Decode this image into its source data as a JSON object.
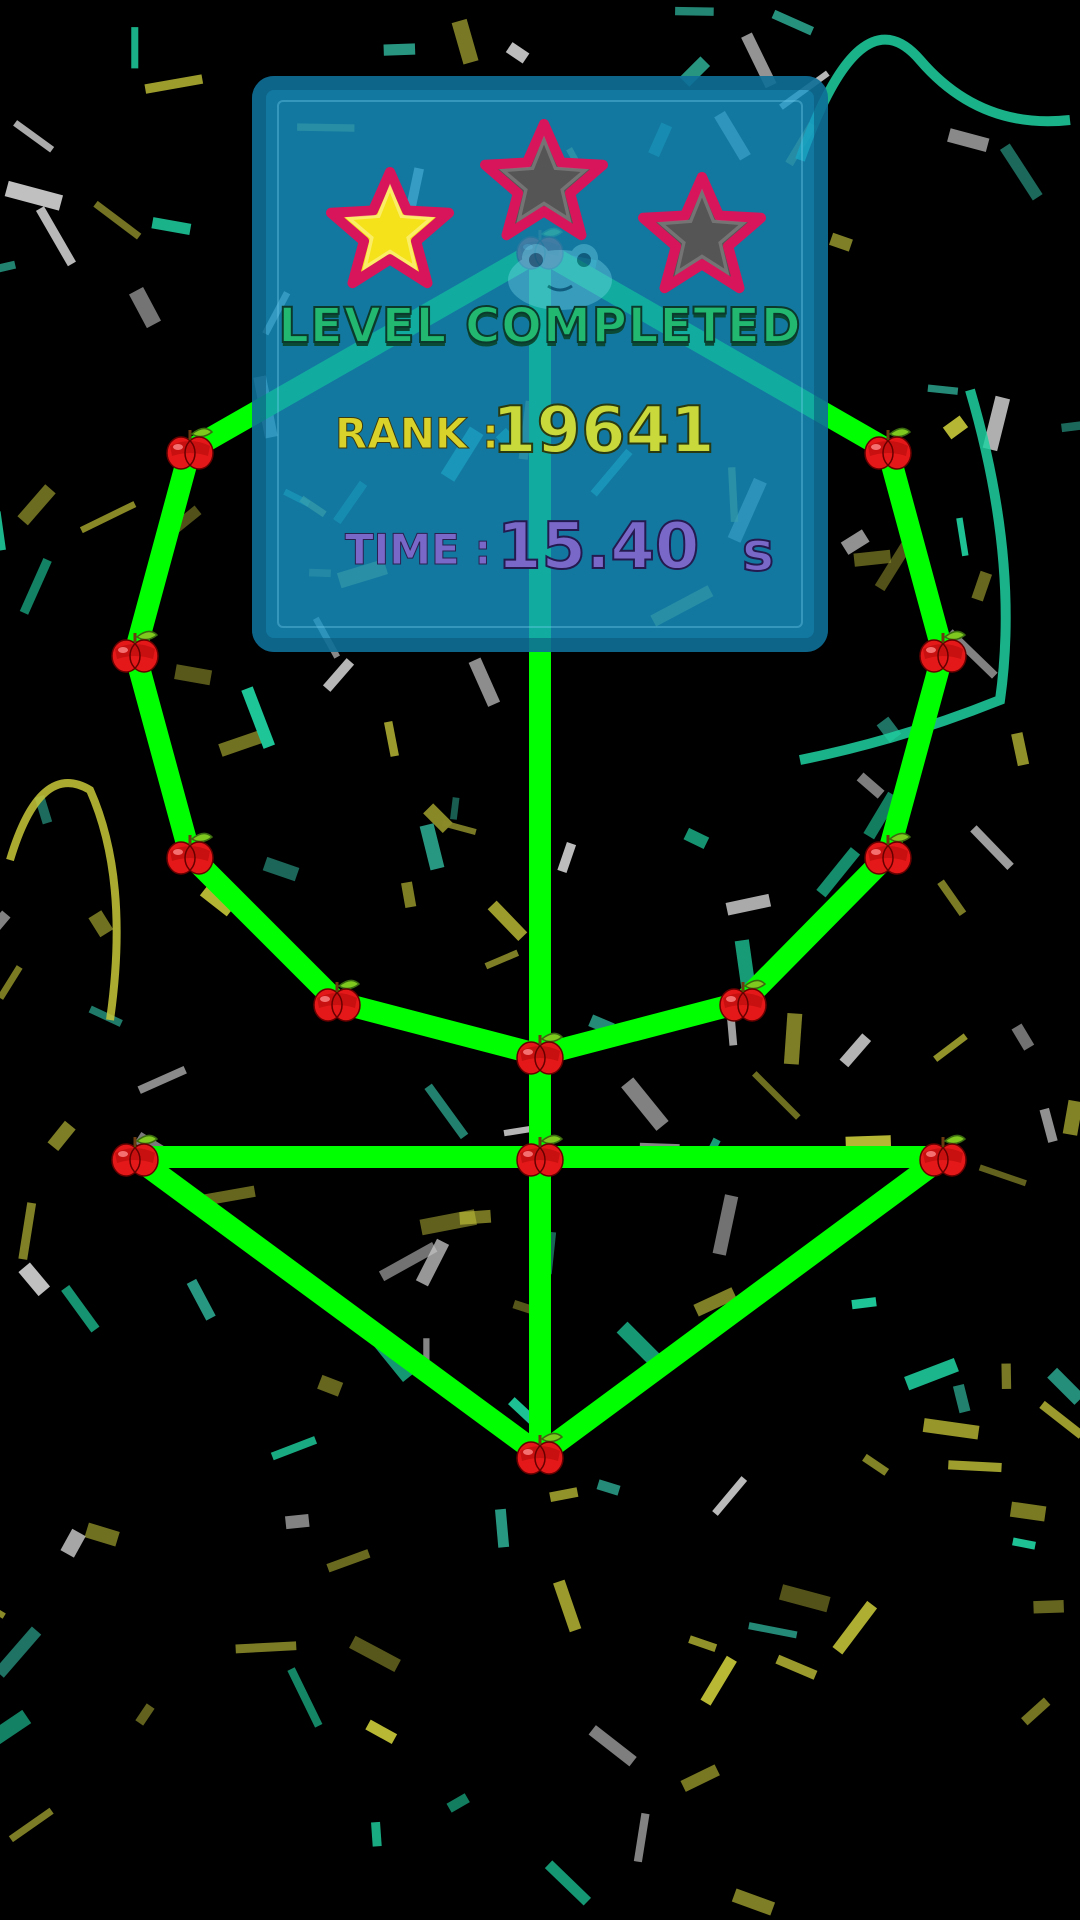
{
  "result_panel": {
    "title": "LEVEL COMPLETED",
    "rank_label": "RANK :",
    "rank_value": "19641",
    "time_label": "TIME :",
    "time_value": "15.40",
    "time_unit": "s",
    "stars_earned": 1,
    "stars_total": 3
  },
  "puzzle": {
    "node_icon": "apple-icon",
    "line_color": "#00ff00",
    "node_count": 15,
    "edge_count": 19
  },
  "colors": {
    "background": "#000000",
    "panel": "#1696c8",
    "star_filled": "#f5e21a",
    "star_empty": "#555555",
    "star_outline": "#d8145a",
    "title": "#22b870",
    "rank": "#c9d83a",
    "time": "#7a68c8"
  }
}
